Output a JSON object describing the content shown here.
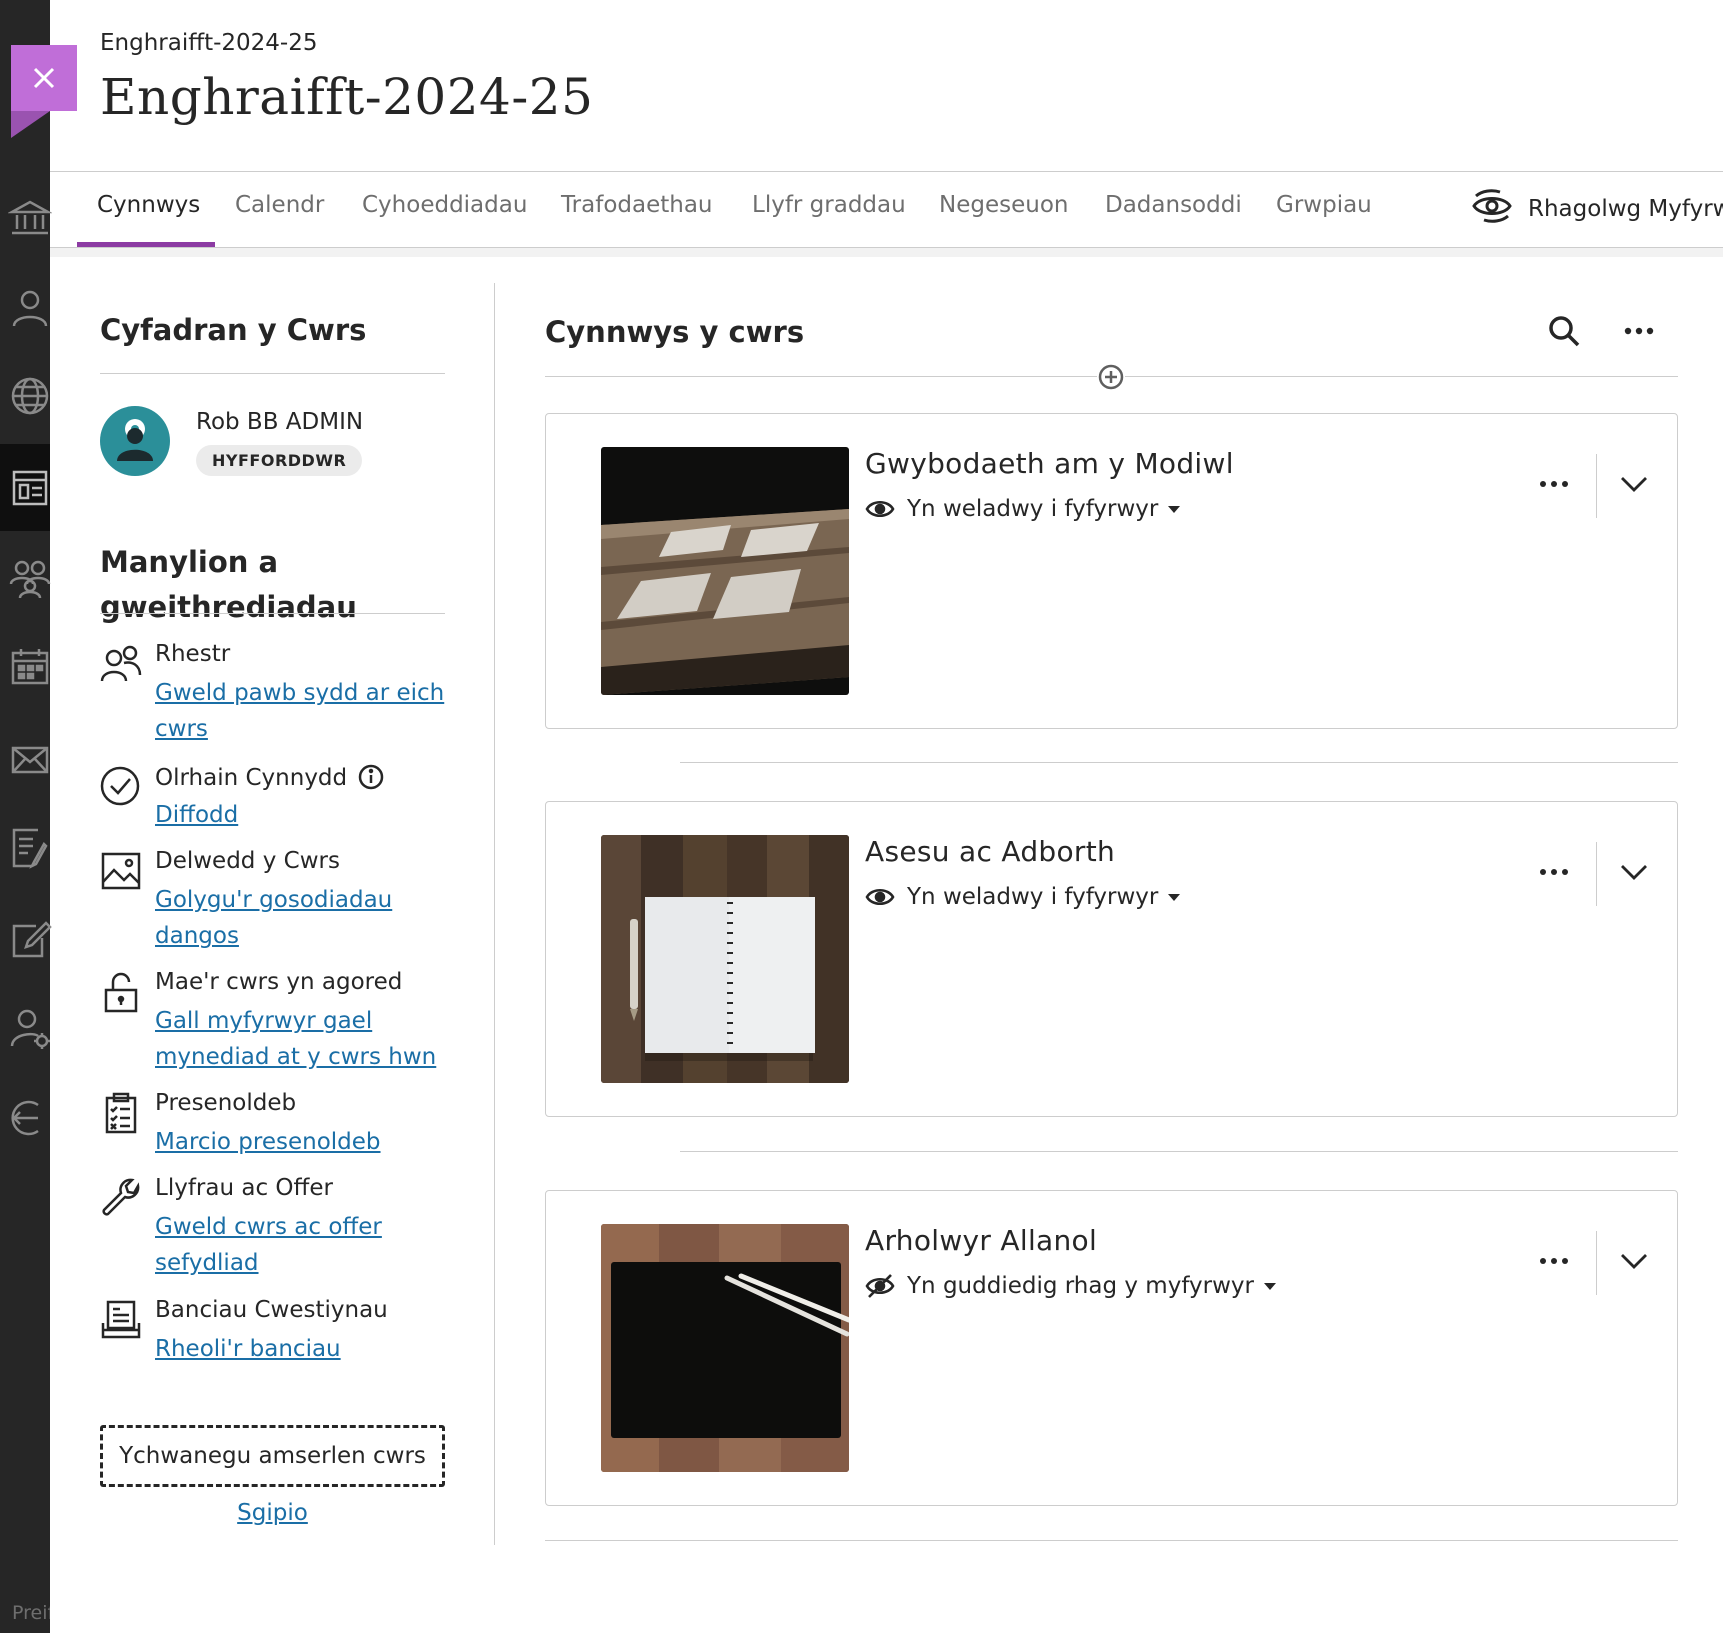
{
  "header": {
    "breadcrumb": "Enghraifft-2024-25",
    "title": "Enghraifft-2024-25"
  },
  "tabs": [
    {
      "label": "Cynnwys",
      "active": true
    },
    {
      "label": "Calendr"
    },
    {
      "label": "Cyhoeddiadau"
    },
    {
      "label": "Trafodaethau"
    },
    {
      "label": "Llyfr graddau"
    },
    {
      "label": "Negeseuon"
    },
    {
      "label": "Dadansoddi"
    },
    {
      "label": "Grwpiau"
    }
  ],
  "student_preview": {
    "label": "Rhagolwg Myfyrwyr",
    "icon": "student-preview-icon"
  },
  "faculty": {
    "heading": "Cyfadran y Cwrs",
    "instructor_name": "Rob BB ADMIN",
    "role": "HYFFORDDWR"
  },
  "details": {
    "heading": "Manylion a gweithrediadau",
    "items": [
      {
        "label": "Rhestr",
        "link": "Gweld pawb sydd ar eich cwrs",
        "icon": "roster-icon"
      },
      {
        "label": "Olrhain Cynnydd",
        "link": "Diffodd",
        "icon": "progress-check-icon"
      },
      {
        "label": "Delwedd y Cwrs",
        "link": "Golygu'r gosodiadau dangos",
        "icon": "image-icon"
      },
      {
        "label": "Mae'r cwrs yn agored",
        "link": "Gall myfyrwyr gael mynediad at y cwrs hwn",
        "icon": "unlock-icon"
      },
      {
        "label": "Presenoldeb",
        "link": "Marcio presenoldeb",
        "icon": "attendance-icon"
      },
      {
        "label": "Llyfrau ac Offer",
        "link": "Gweld cwrs ac offer sefydliad",
        "icon": "wrench-icon"
      },
      {
        "label": "Banciau Cwestiynau",
        "link": "Rheoli'r banciau",
        "icon": "question-bank-icon"
      }
    ],
    "add_schedule_label": "Ychwanegu amserlen cwrs",
    "skip_label": "Sgipio"
  },
  "content": {
    "heading": "Cynnwys y cwrs",
    "items": [
      {
        "title": "Gwybodaeth am y Modiwl",
        "visibility": "Yn weladwy i fyfyrwyr",
        "visible": true
      },
      {
        "title": "Asesu ac Adborth",
        "visibility": "Yn weladwy i fyfyrwyr",
        "visible": true
      },
      {
        "title": "Arholwyr Allanol",
        "visibility": "Yn guddiedig rhag y myfyrwyr",
        "visible": false
      }
    ]
  },
  "rail_footer": "Preif",
  "colors": {
    "accent": "#8c3ba3",
    "close_button": "#c06ed8",
    "link": "#1a6ea6",
    "avatar": "#2b8f99",
    "rail": "#262626"
  }
}
